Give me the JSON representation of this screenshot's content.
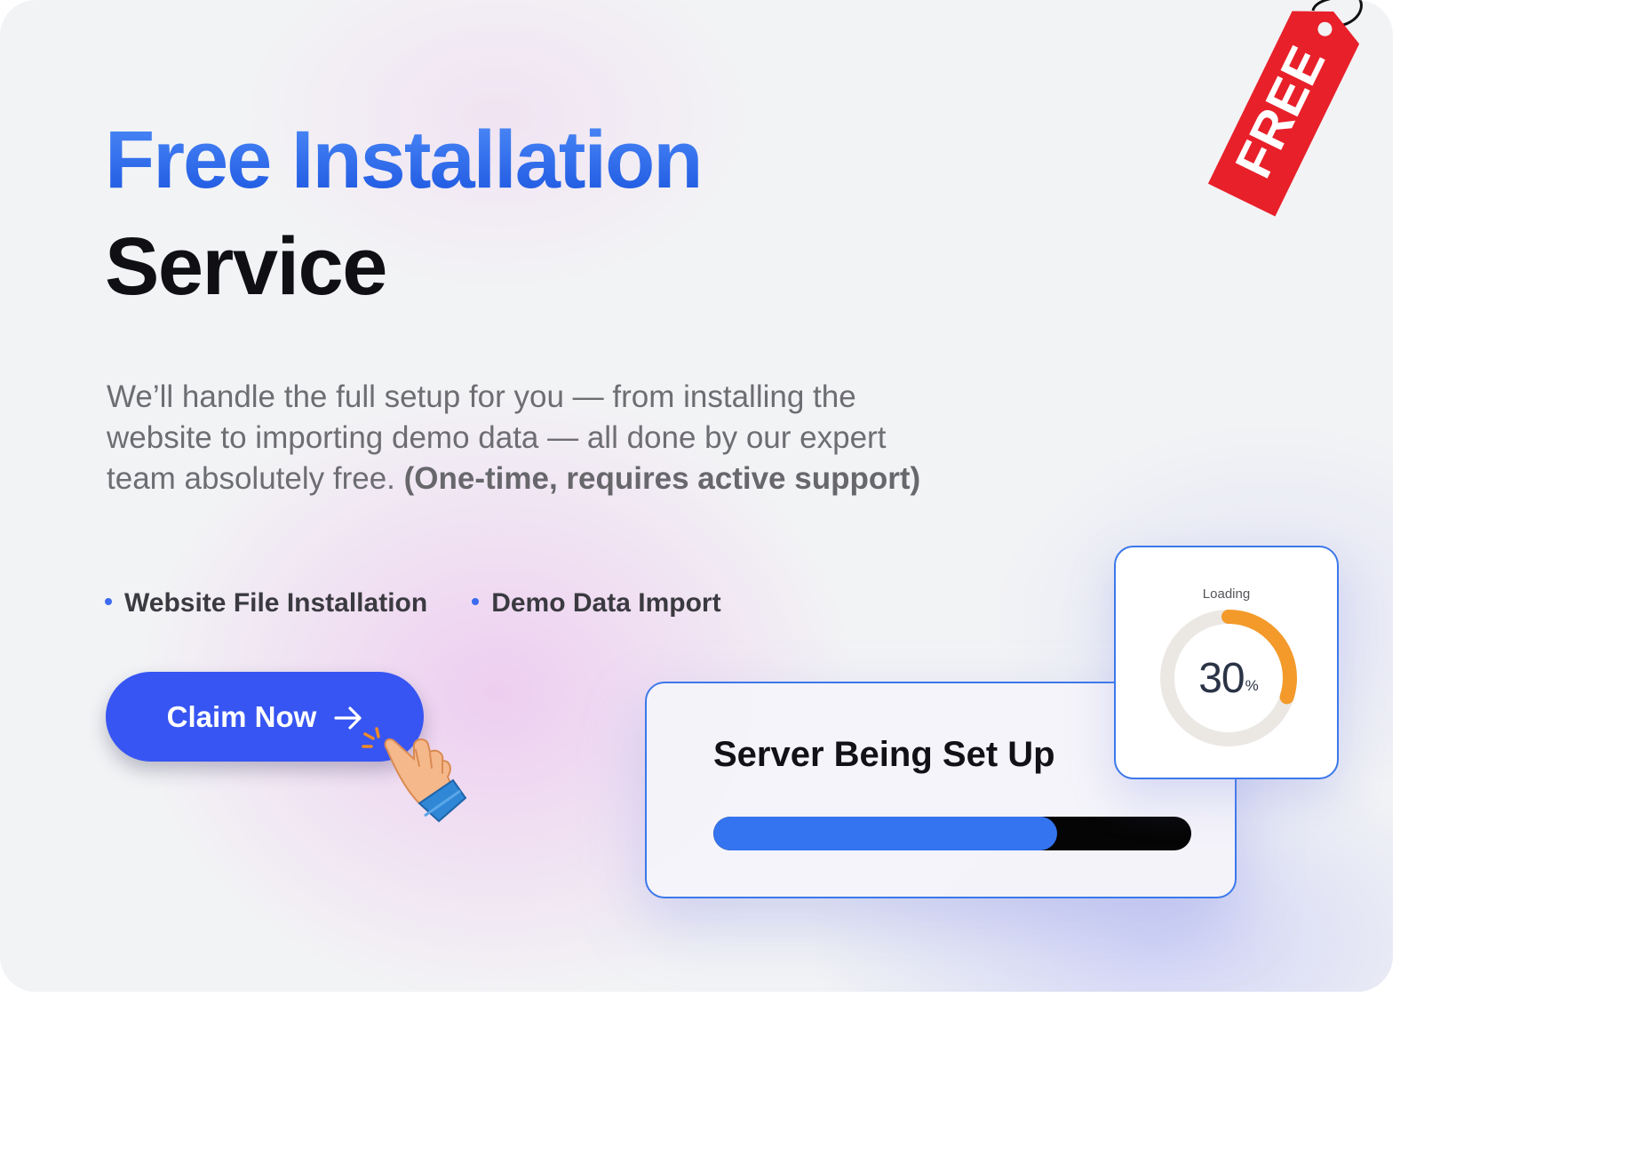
{
  "hero": {
    "title_line1": "Free Installation",
    "title_line2": "Service",
    "description": "We’ll handle the full setup for you — from installing the website to importing demo data — all done by our expert team absolutely free.",
    "description_bold": "(One-time, requires active support)"
  },
  "features": [
    {
      "label": "Website File Installation"
    },
    {
      "label": "Demo Data Import"
    }
  ],
  "cta": {
    "label": "Claim Now",
    "icon": "arrow-right-icon"
  },
  "tag": {
    "text": "FREE",
    "color": "#e8202a"
  },
  "server_status": {
    "title": "Server Being Set Up",
    "progress": 0.72
  },
  "loading": {
    "label": "Loading",
    "value": "30",
    "unit": "%",
    "fraction": 0.3
  },
  "colors": {
    "brand_blue": "#3755f2",
    "title_blue": "#1b55e0",
    "progress_blue": "#3474f0",
    "ring_orange": "#f39a2b",
    "ring_track": "#ebe8e4",
    "card_border": "#3b78ea"
  }
}
